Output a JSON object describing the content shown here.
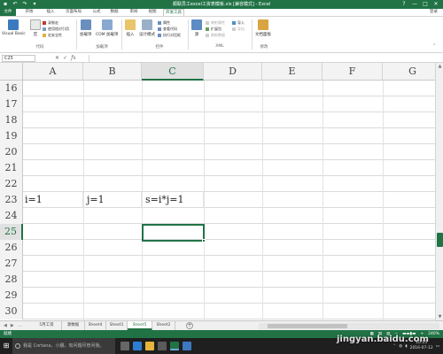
{
  "window": {
    "title": "顺联员工excel工资表模板.xls [兼容模式] - Excel",
    "qat_icons": [
      "save-icon",
      "undo-icon",
      "redo-icon",
      "customize-icon"
    ],
    "controls": [
      "?",
      "—",
      "□",
      "✕"
    ]
  },
  "ribbon": {
    "tabs": [
      "文件",
      "开始",
      "插入",
      "页面布局",
      "公式",
      "数据",
      "审阅",
      "视图",
      "开发工具"
    ],
    "active_tab": "开发工具",
    "sign_in": "登录",
    "groups": [
      "代码",
      "加载项",
      "控件",
      "XML",
      "修改"
    ],
    "code": {
      "visual_basic": "Visual Basic",
      "macros": "宏",
      "record": "录制宏",
      "relative": "使用相对引用",
      "security": "宏安全性"
    },
    "addins": {
      "addins": "加载项",
      "com": "COM 加载项"
    },
    "controls": {
      "insert": "插入",
      "design": "设计模式",
      "properties": "属性",
      "view_code": "查看代码",
      "run_dialog": "执行对话框"
    },
    "xml": {
      "source": "源",
      "map_props": "映射属性",
      "expansion": "扩展包",
      "refresh": "刷新数据",
      "import": "导入",
      "export": "导出"
    },
    "modify": {
      "doc_panel": "文档面板"
    }
  },
  "formula_bar": {
    "name_box": "C25",
    "fx": "fx",
    "value": ""
  },
  "columns": [
    "A",
    "B",
    "C",
    "D",
    "E",
    "F",
    "G"
  ],
  "selected_column": "C",
  "rows": [
    "16",
    "17",
    "18",
    "19",
    "20",
    "21",
    "22",
    "23",
    "24",
    "25",
    "26",
    "27",
    "28",
    "29",
    "30"
  ],
  "selected_row": "25",
  "cells": {
    "A23": "i=1",
    "B23": "j=1",
    "C23": "s=i*j=1"
  },
  "sheets": [
    "5月工资",
    "源数据",
    "Sheet4",
    "Sheet1",
    "Sheet5",
    "Sheet2"
  ],
  "active_sheet": "Sheet5",
  "status": {
    "ready": "就绪",
    "zoom": "240%"
  },
  "taskbar": {
    "search_placeholder": "我是 Cortana，小娜。有问题尽管问我。",
    "time": "10:15",
    "date": "2016-07-12"
  },
  "watermark": "jingyan.baidu.com",
  "colors": {
    "excel_green": "#217346",
    "taskbar": "#1f1f1f"
  }
}
